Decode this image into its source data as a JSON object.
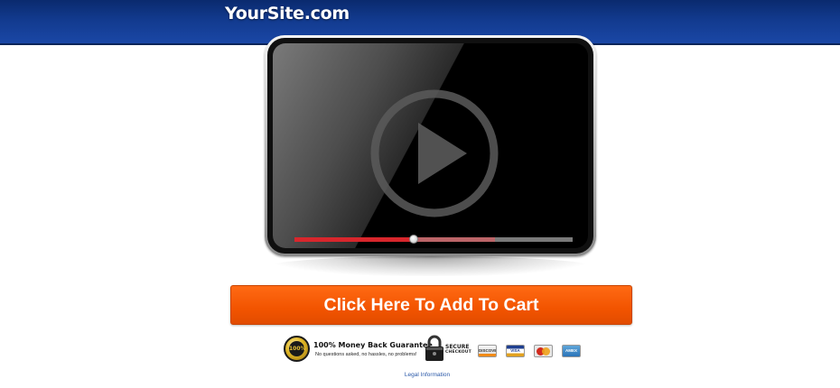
{
  "header": {
    "site_title": "YourSite.com",
    "bg_color": "#123a8e"
  },
  "video": {
    "played_fraction": 0.43,
    "buffered_fraction": 0.72,
    "progress_color": "#d8262c",
    "play_icon": "play-icon"
  },
  "cta": {
    "label": "Click Here To Add To Cart",
    "color": "#f25400"
  },
  "trust": {
    "seal_text": "100%",
    "guarantee_title": "100% Money Back Guarantee",
    "guarantee_subtitle": "No questions asked, no hassles, no problems!",
    "secure_line1": "SECURE",
    "secure_line2": "CHECKOUT",
    "cards": [
      {
        "name": "discover-card-icon",
        "label": "DISCOVER"
      },
      {
        "name": "visa-card-icon",
        "label": "VISA"
      },
      {
        "name": "mastercard-card-icon",
        "label": ""
      },
      {
        "name": "amex-card-icon",
        "label": "AMEX"
      }
    ]
  },
  "footer": {
    "legal_link": "Legal Information"
  }
}
